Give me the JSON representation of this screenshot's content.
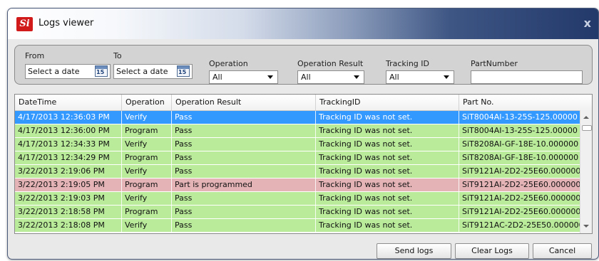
{
  "window": {
    "title": "Logs viewer",
    "logo_text": "Si",
    "close_label": "x"
  },
  "filters": {
    "from": {
      "label": "From",
      "value": "Select a date",
      "cal_day": "15"
    },
    "to": {
      "label": "To",
      "value": "Select a date",
      "cal_day": "15"
    },
    "operation": {
      "label": "Operation",
      "value": "All"
    },
    "operation_result": {
      "label": "Operation Result",
      "value": "All"
    },
    "tracking_id": {
      "label": "Tracking ID",
      "value": "All"
    },
    "part_number": {
      "label": "PartNumber",
      "value": ""
    }
  },
  "table": {
    "columns": [
      "DateTime",
      "Operation",
      "Operation Result",
      "TrackingID",
      "Part No."
    ],
    "rows": [
      {
        "status": "selected",
        "cells": [
          "4/17/2013 12:36:03 PM",
          "Verify",
          "Pass",
          "Tracking ID was not set.",
          "SiT8004AI-13-25S-125.00000"
        ]
      },
      {
        "status": "pass",
        "cells": [
          "4/17/2013 12:36:00 PM",
          "Program",
          "Pass",
          "Tracking ID was not set.",
          "SiT8004AI-13-25S-125.00000"
        ]
      },
      {
        "status": "pass",
        "cells": [
          "4/17/2013 12:34:33 PM",
          "Verify",
          "Pass",
          "Tracking ID was not set.",
          "SiT8208AI-GF-18E-10.000000"
        ]
      },
      {
        "status": "pass",
        "cells": [
          "4/17/2013 12:34:29 PM",
          "Program",
          "Pass",
          "Tracking ID was not set.",
          "SiT8208AI-GF-18E-10.000000"
        ]
      },
      {
        "status": "pass",
        "cells": [
          "3/22/2013 2:19:06 PM",
          "Verify",
          "Pass",
          "Tracking ID was not set.",
          "SiT9121AI-2D2-25E60.000000"
        ]
      },
      {
        "status": "fail",
        "cells": [
          "3/22/2013 2:19:05 PM",
          "Program",
          "Part is programmed",
          "Tracking ID was not set.",
          "SiT9121AI-2D2-25E60.000000"
        ]
      },
      {
        "status": "pass",
        "cells": [
          "3/22/2013 2:19:03 PM",
          "Verify",
          "Pass",
          "Tracking ID was not set.",
          "SiT9121AI-2D2-25E60.000000"
        ]
      },
      {
        "status": "pass",
        "cells": [
          "3/22/2013 2:18:58 PM",
          "Program",
          "Pass",
          "Tracking ID was not set.",
          "SiT9121AI-2D2-25E60.000000"
        ]
      },
      {
        "status": "pass",
        "cells": [
          "3/22/2013 2:18:08 PM",
          "Verify",
          "Pass",
          "Tracking ID was not set.",
          "SiT9121AC-2D2-25E50.000000"
        ]
      }
    ]
  },
  "buttons": {
    "send_logs": "Send logs",
    "clear_logs": "Clear Logs",
    "cancel": "Cancel"
  },
  "colors": {
    "pass_row": "#b9eb9a",
    "fail_row": "#e4b3b6",
    "selected_row": "#3399ff"
  }
}
